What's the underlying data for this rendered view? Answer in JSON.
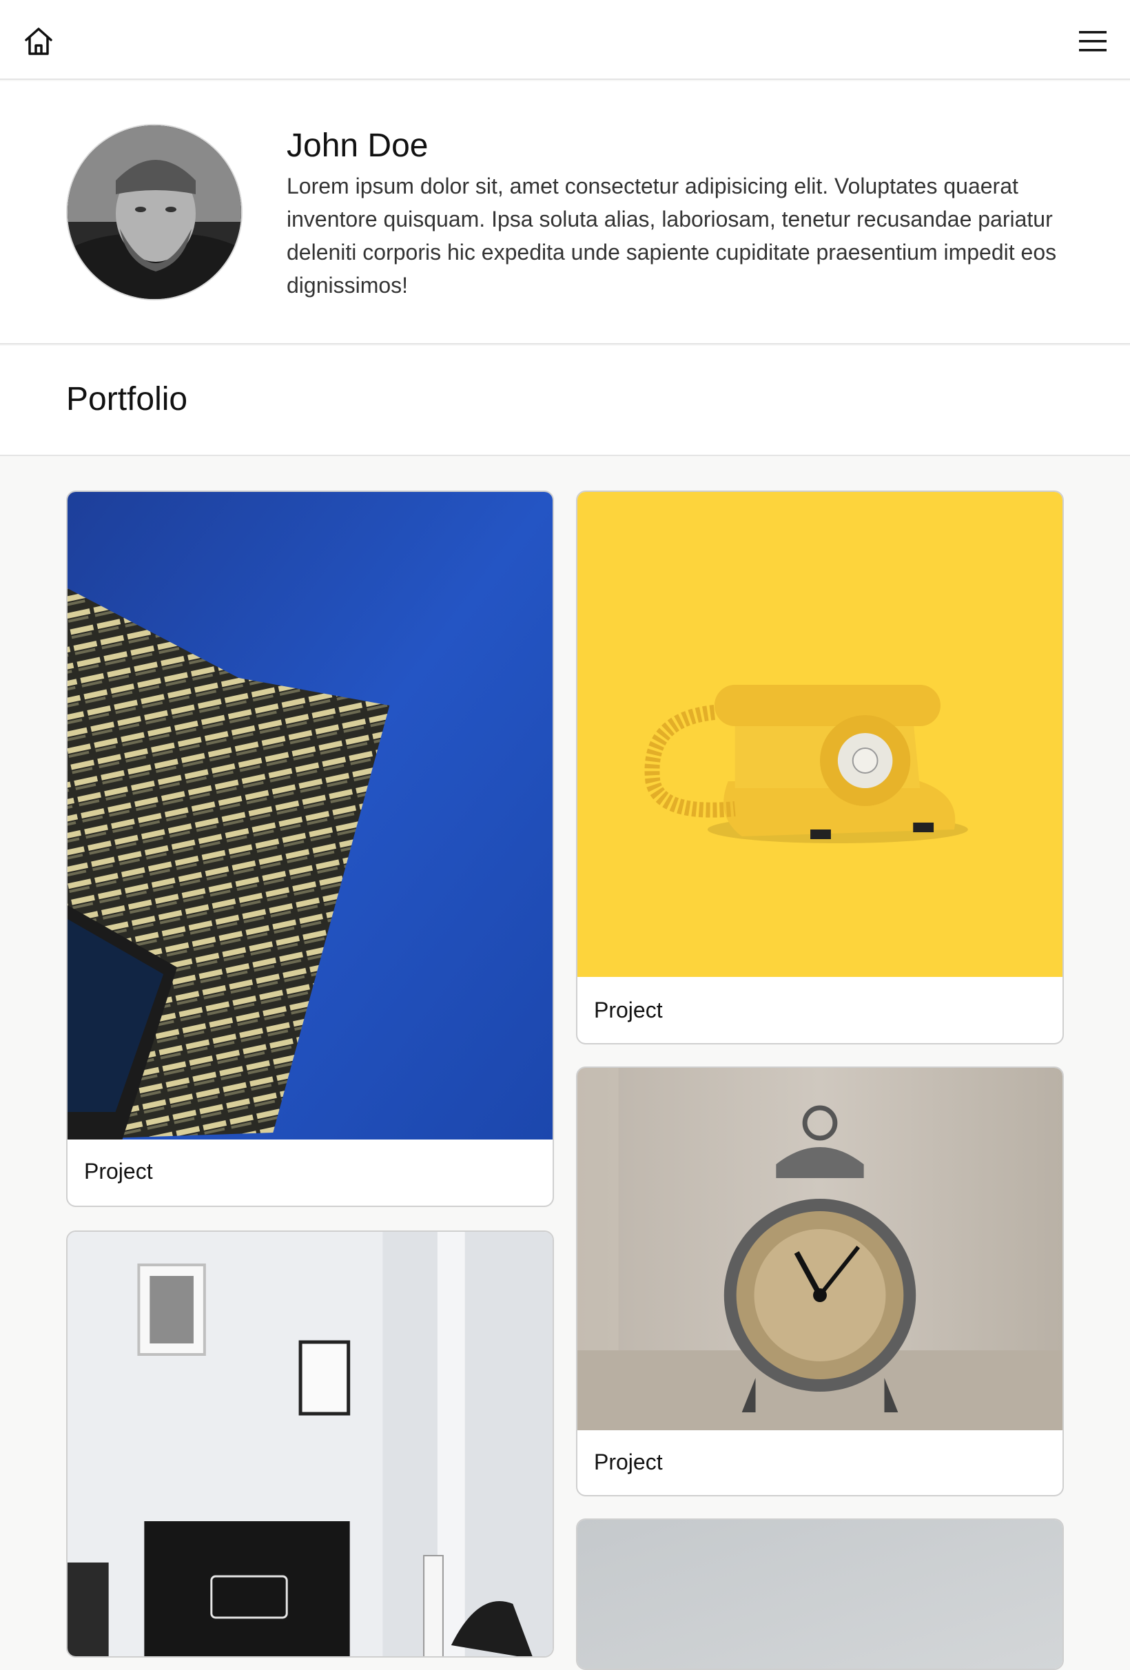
{
  "nav": {
    "home_icon": "home-icon",
    "menu_icon": "hamburger-menu-icon"
  },
  "profile": {
    "name": "John Doe",
    "bio": "Lorem ipsum dolor sit, amet consectetur adipisicing elit. Voluptates quaerat inventore quisquam. Ipsa soluta alias, laboriosam, tenetur recusandae pariatur deleniti corporis hic expedita unde sapiente cupiditate praesentium impedit eos dignissimos!"
  },
  "portfolio": {
    "title": "Portfolio",
    "projects": [
      {
        "label": "Project",
        "image": "building-photo"
      },
      {
        "label": "Project",
        "image": "yellow-telephone-photo"
      },
      {
        "label": "Project",
        "image": "alarm-clock-photo"
      },
      {
        "label": "",
        "image": "desk-room-photo"
      },
      {
        "label": "",
        "image": "grey-photo"
      }
    ]
  },
  "colors": {
    "accent_yellow": "#fdd43c",
    "sky_blue": "#1f4fb8",
    "divider": "#e4e4e4"
  }
}
